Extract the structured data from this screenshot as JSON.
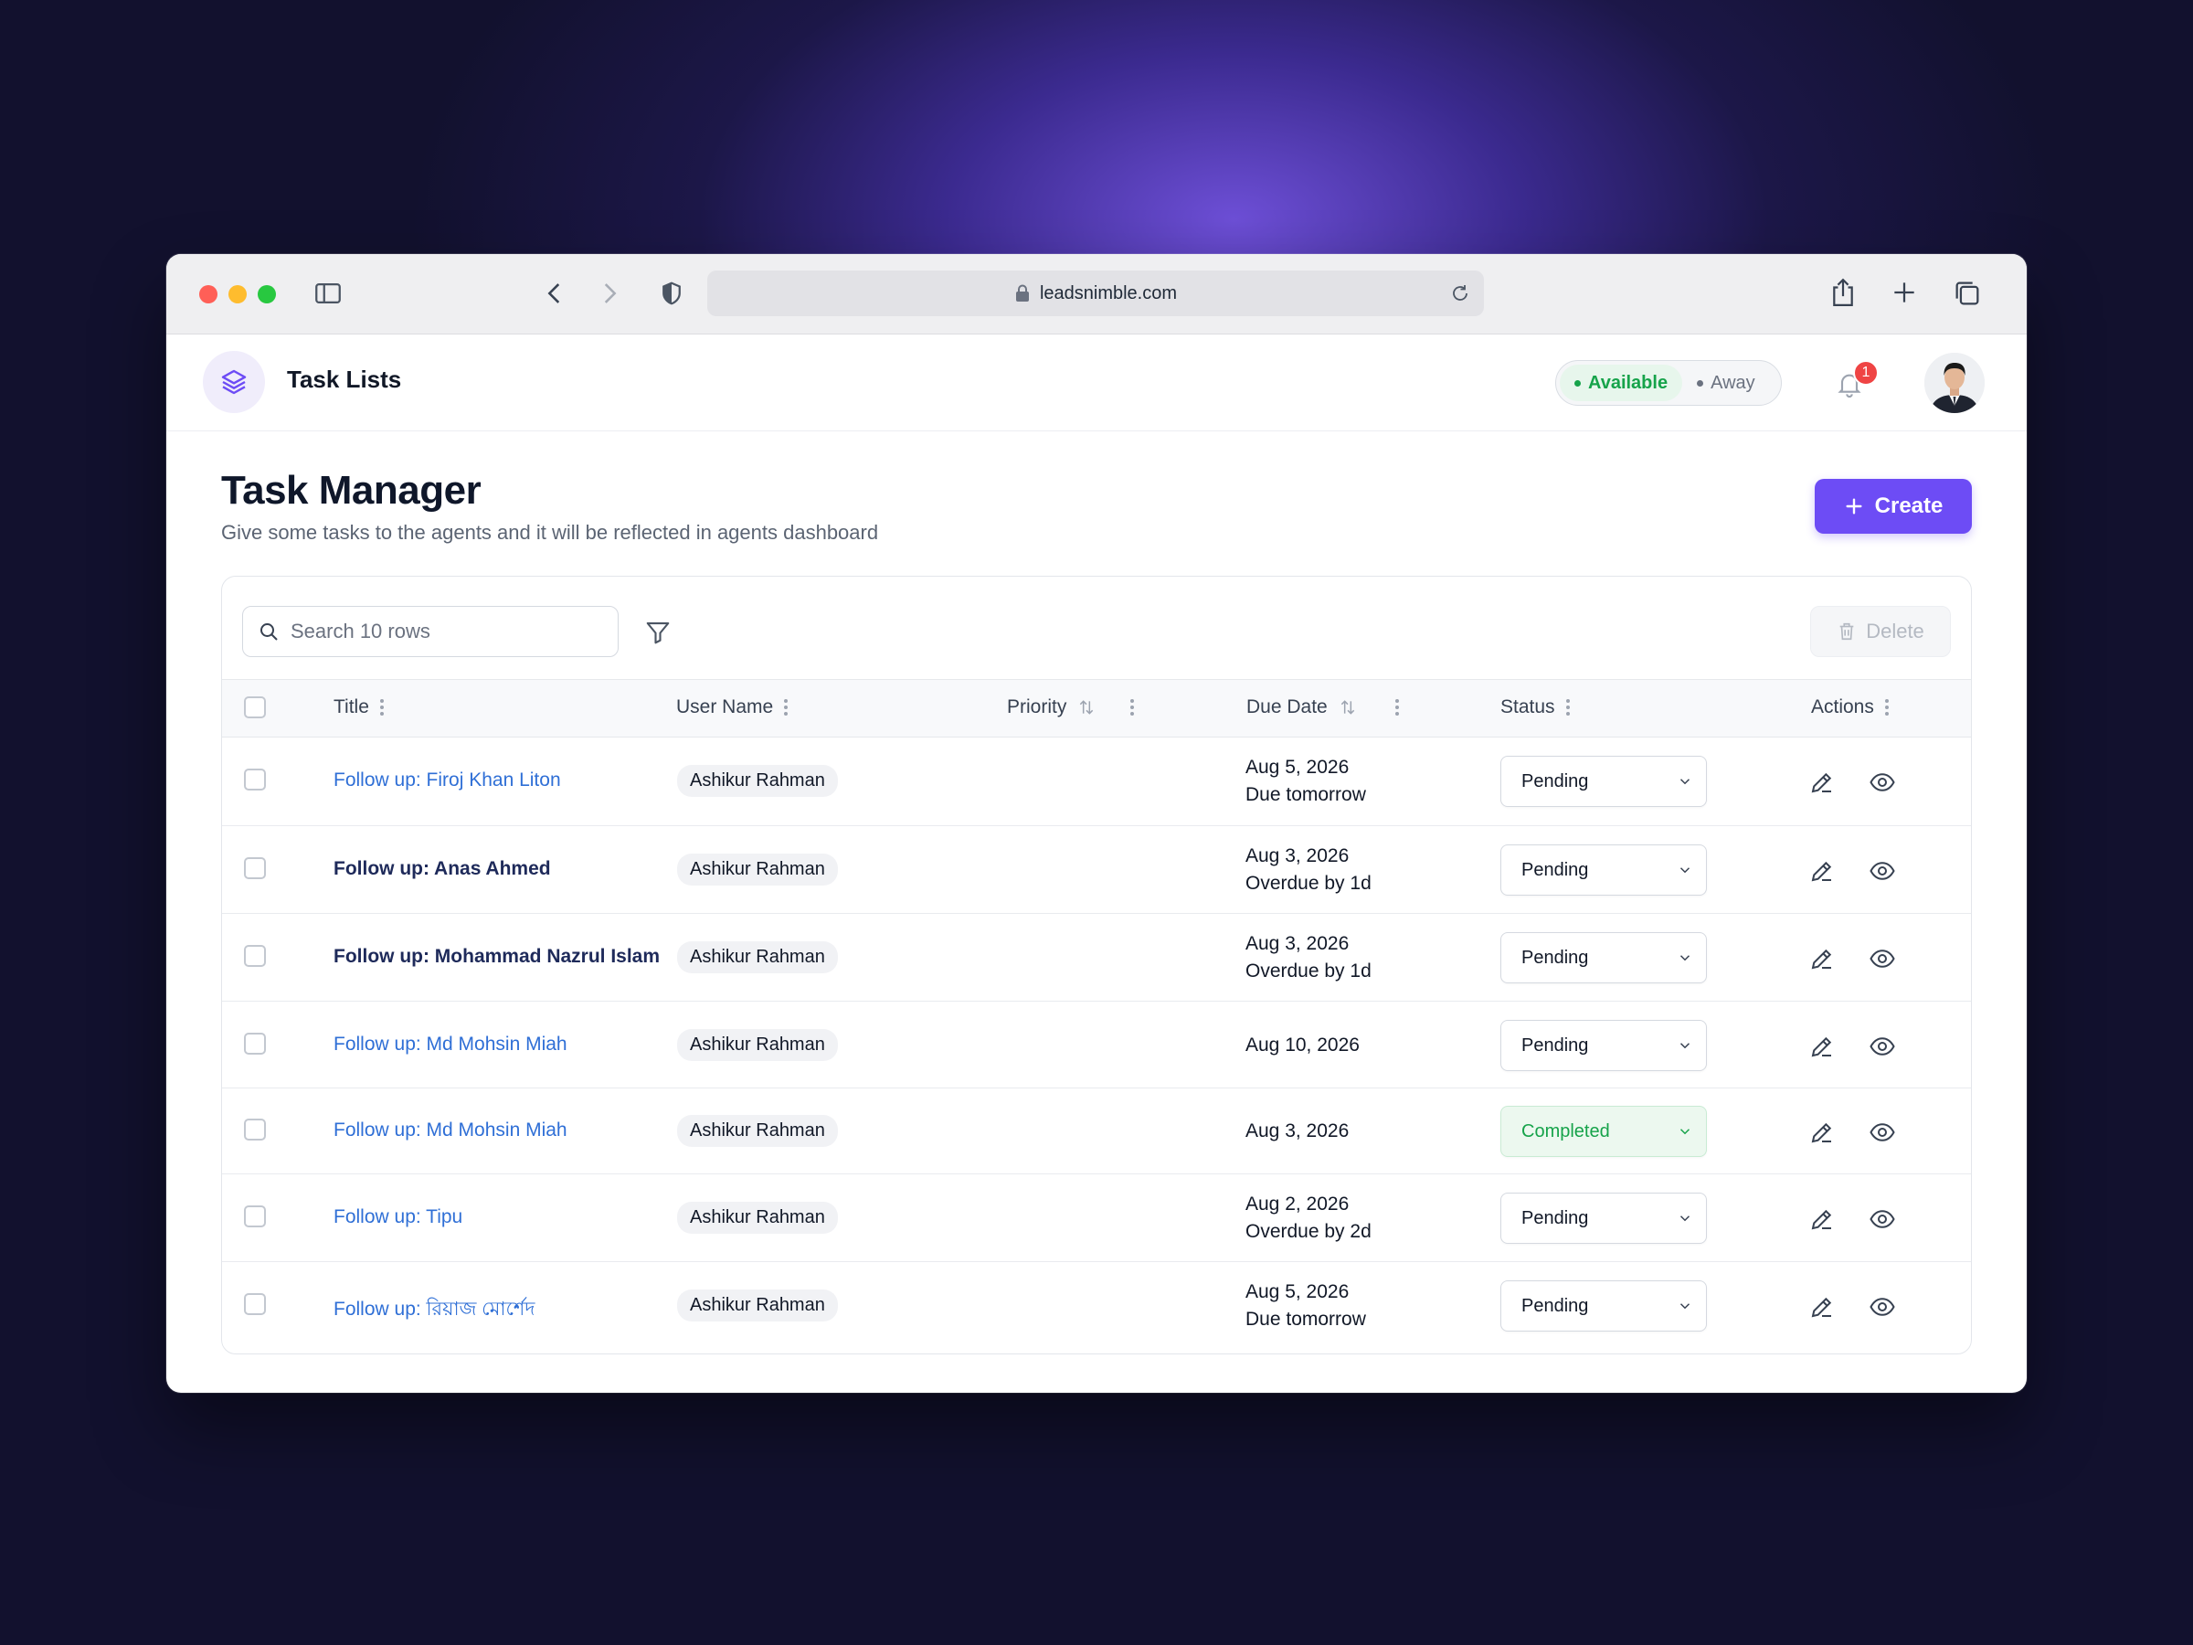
{
  "browser": {
    "url": "leadsnimble.com",
    "traffic_colors": [
      "#ff5f57",
      "#febc2e",
      "#28c840"
    ]
  },
  "app": {
    "title": "Task Lists",
    "accent": "#6d4cf5"
  },
  "presence": {
    "available_label": "Available",
    "away_label": "Away",
    "selected": "Available"
  },
  "notifications": {
    "count": "1"
  },
  "page": {
    "title": "Task Manager",
    "subtitle": "Give some tasks to the agents and it will be reflected in agents dashboard",
    "create_label": "Create"
  },
  "toolbar": {
    "search_placeholder": "Search 10 rows",
    "delete_label": "Delete"
  },
  "table": {
    "columns": {
      "title": "Title",
      "user": "User Name",
      "priority": "Priority",
      "due": "Due Date",
      "status": "Status",
      "actions": "Actions"
    },
    "rows": [
      {
        "title": "Follow up: Firoj Khan Liton",
        "user": "Ashikur Rahman",
        "due_date": "Aug 5, 2026",
        "due_note": "Due tomorrow",
        "status": "Pending"
      },
      {
        "title": "Follow up: Anas Ahmed",
        "user": "Ashikur Rahman",
        "due_date": "Aug 3, 2026",
        "due_note": "Overdue by 1d",
        "status": "Pending"
      },
      {
        "title": "Follow up: Mohammad Nazrul Islam",
        "user": "Ashikur Rahman",
        "due_date": "Aug 3, 2026",
        "due_note": "Overdue by 1d",
        "status": "Pending"
      },
      {
        "title": "Follow up: Md Mohsin Miah",
        "user": "Ashikur Rahman",
        "due_date": "Aug 10, 2026",
        "due_note": "",
        "status": "Pending"
      },
      {
        "title": "Follow up: Md Mohsin Miah",
        "user": "Ashikur Rahman",
        "due_date": "Aug 3, 2026",
        "due_note": "",
        "status": "Completed"
      },
      {
        "title": "Follow up: Tipu",
        "user": "Ashikur Rahman",
        "due_date": "Aug 2, 2026",
        "due_note": "Overdue by 2d",
        "status": "Pending"
      },
      {
        "title": "Follow up: রিয়াজ মোর্শেদ",
        "user": "Ashikur Rahman",
        "due_date": "Aug 5, 2026",
        "due_note": "Due tomorrow",
        "status": "Pending"
      }
    ]
  }
}
